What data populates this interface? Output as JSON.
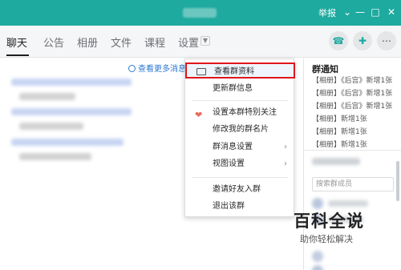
{
  "titlebar": {
    "report_label": "举报",
    "icons": [
      "chevron-down-icon",
      "minimize-icon",
      "maximize-icon",
      "close-icon"
    ]
  },
  "tabs": [
    {
      "label": "聊天",
      "active": true
    },
    {
      "label": "公告"
    },
    {
      "label": "相册"
    },
    {
      "label": "文件"
    },
    {
      "label": "课程"
    },
    {
      "label": "设置"
    }
  ],
  "toolbar_icons": [
    "phone-icon",
    "add-chat-icon",
    "more-icon"
  ],
  "chat": {
    "more_messages": "查看更多消息"
  },
  "context_menu": {
    "items": [
      {
        "label": "查看群资料",
        "highlighted": true
      },
      {
        "label": "更新群信息"
      },
      {
        "label": "设置本群特别关注"
      },
      {
        "label": "修改我的群名片"
      },
      {
        "label": "群消息设置"
      },
      {
        "label": "视图设置"
      },
      {
        "label": "邀请好友入群"
      },
      {
        "label": "退出该群"
      }
    ]
  },
  "group_notice": {
    "title": "群通知",
    "items": [
      "【相册】《后宫》新增1张",
      "【相册】《后宫》新增1张",
      "【相册】《后宫》新增1张",
      "【相册】新增1张",
      "【相册】新增1张",
      "【相册】新增1张"
    ]
  },
  "members": {
    "search_placeholder": "搜索群成员"
  },
  "watermark": {
    "main": "百科全说",
    "sub": "助你轻松解决"
  },
  "colors": {
    "titlebar": "#1eaa9f",
    "highlight_border": "#e0161b",
    "link": "#2b78d1"
  }
}
